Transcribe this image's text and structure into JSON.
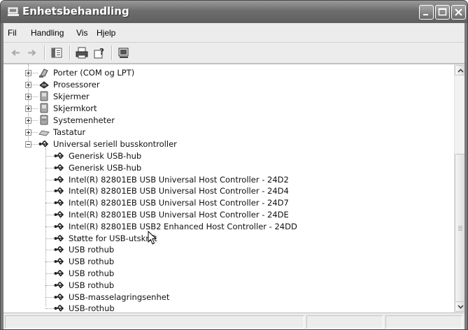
{
  "window": {
    "title": "Enhetsbehandling"
  },
  "menubar": {
    "items": [
      "Fil",
      "Handling",
      "Vis",
      "Hjelp"
    ]
  },
  "toolbar": {
    "buttons": [
      "back-icon",
      "forward-icon",
      "properties-icon",
      "print-icon",
      "help-icon",
      "update-driver-icon"
    ]
  },
  "tree": {
    "collapsed_categories": [
      {
        "label": "Porter (COM og LPT)",
        "icon": "port-icon"
      },
      {
        "label": "Prosessorer",
        "icon": "processor-icon"
      },
      {
        "label": "Skjermer",
        "icon": "monitor-icon"
      },
      {
        "label": "Skjermkort",
        "icon": "display-adapter-icon"
      },
      {
        "label": "Systemenheter",
        "icon": "system-device-icon"
      },
      {
        "label": "Tastatur",
        "icon": "keyboard-icon"
      }
    ],
    "expanded_category": {
      "label": "Universal seriell busskontroller",
      "icon": "usb-icon",
      "children": [
        "Generisk USB-hub",
        "Generisk USB-hub",
        "Intel(R) 82801EB USB Universal Host Controller - 24D2",
        "Intel(R) 82801EB USB Universal Host Controller - 24D4",
        "Intel(R) 82801EB USB Universal Host Controller - 24D7",
        "Intel(R) 82801EB USB Universal Host Controller - 24DE",
        "Intel(R) 82801EB USB2 Enhanced Host Controller - 24DD",
        "Støtte for USB-utskrift",
        "USB rothub",
        "USB rothub",
        "USB rothub",
        "USB rothub",
        "USB-masselagringsenhet",
        "USB-rothub"
      ]
    }
  },
  "colors": {
    "titlebar": "#6d6d6d",
    "chrome": "#ececec",
    "content": "#ffffff"
  }
}
